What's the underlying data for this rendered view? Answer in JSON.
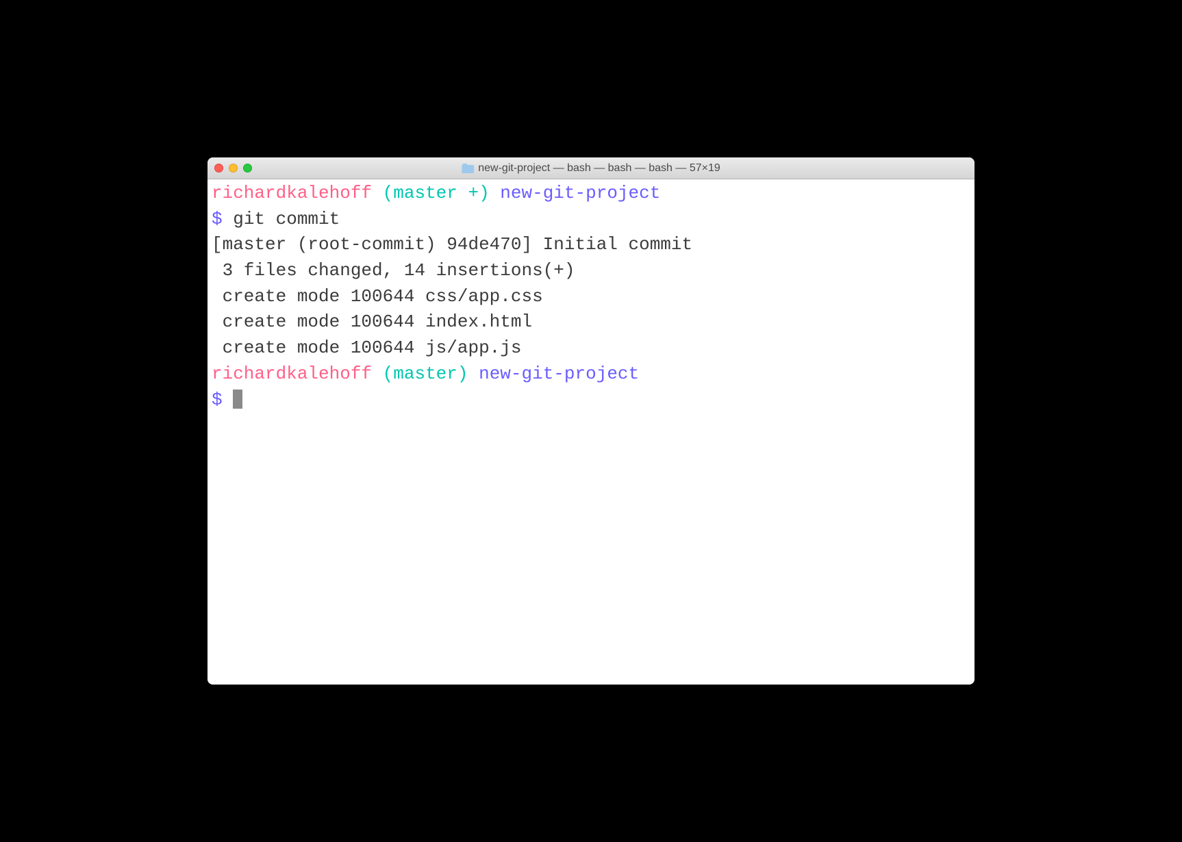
{
  "window": {
    "title": "new-git-project — bash — bash — bash — 57×19"
  },
  "colors": {
    "user": "#ff5f87",
    "branch": "#00c7b0",
    "dir": "#6a5cff",
    "prompt": "#6a5cff",
    "output": "#3b3b3b"
  },
  "prompt1": {
    "user": "richardkalehoff",
    "branch": "(master +)",
    "dir": "new-git-project",
    "symbol": "$",
    "command": "git commit"
  },
  "output": {
    "line1": "[master (root-commit) 94de470] Initial commit",
    "line2": " 3 files changed, 14 insertions(+)",
    "line3": " create mode 100644 css/app.css",
    "line4": " create mode 100644 index.html",
    "line5": " create mode 100644 js/app.js"
  },
  "prompt2": {
    "user": "richardkalehoff",
    "branch": "(master)",
    "dir": "new-git-project",
    "symbol": "$"
  }
}
